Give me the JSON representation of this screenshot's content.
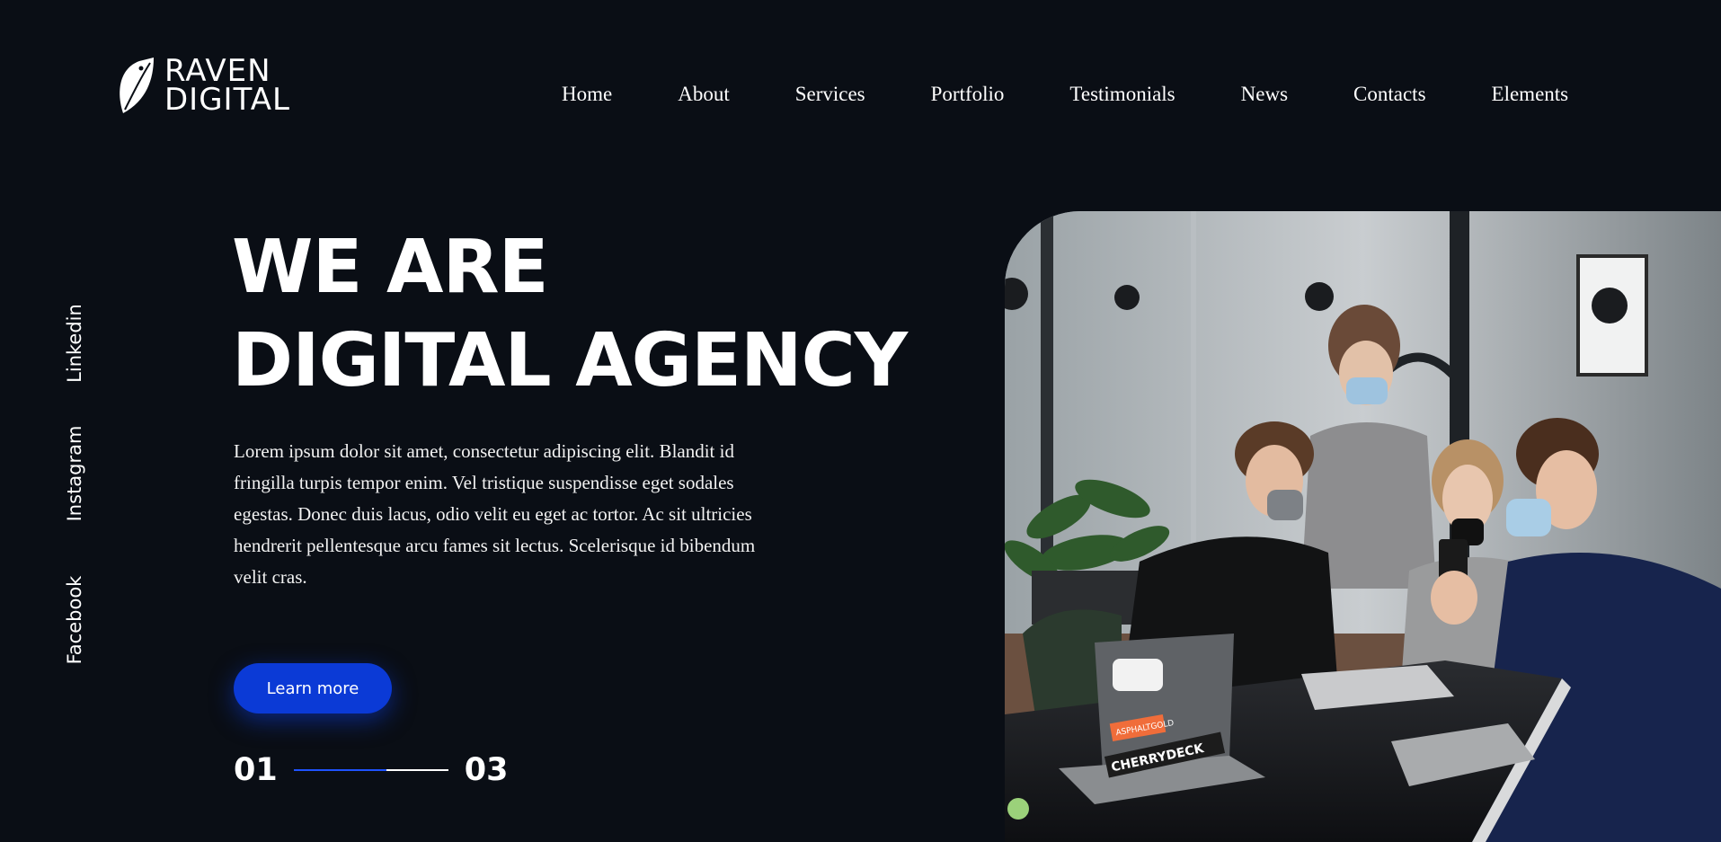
{
  "brand": {
    "line1": "RAVEN",
    "line2": "DIGITAL"
  },
  "nav": [
    {
      "label": "Home"
    },
    {
      "label": "About"
    },
    {
      "label": "Services"
    },
    {
      "label": "Portfolio"
    },
    {
      "label": "Testimonials"
    },
    {
      "label": "News"
    },
    {
      "label": "Contacts"
    },
    {
      "label": "Elements"
    }
  ],
  "social": [
    {
      "label": "Linkedin"
    },
    {
      "label": "Instagram"
    },
    {
      "label": "Facebook"
    }
  ],
  "hero": {
    "title_line1": "WE ARE",
    "title_line2": "DIGITAL AGENCY",
    "description": "Lorem ipsum dolor sit amet, consectetur adipiscing elit. Blandit id fringilla turpis tempor enim. Vel tristique suspendisse eget sodales egestas. Donec duis lacus, odio velit eu eget ac tortor. Ac sit ultricies hendrerit pellentesque arcu fames sit lectus. Scelerisque id bibendum velit cras.",
    "cta_label": "Learn more"
  },
  "slider": {
    "current": "01",
    "total": "03",
    "progress": 0.6
  },
  "photo": {
    "laptop_sticker_1": "CHERRYDECK",
    "laptop_sticker_2": "ASPHALTGOLD"
  },
  "colors": {
    "background": "#0a0e15",
    "accent": "#0b3ad6",
    "text": "#ffffff"
  }
}
